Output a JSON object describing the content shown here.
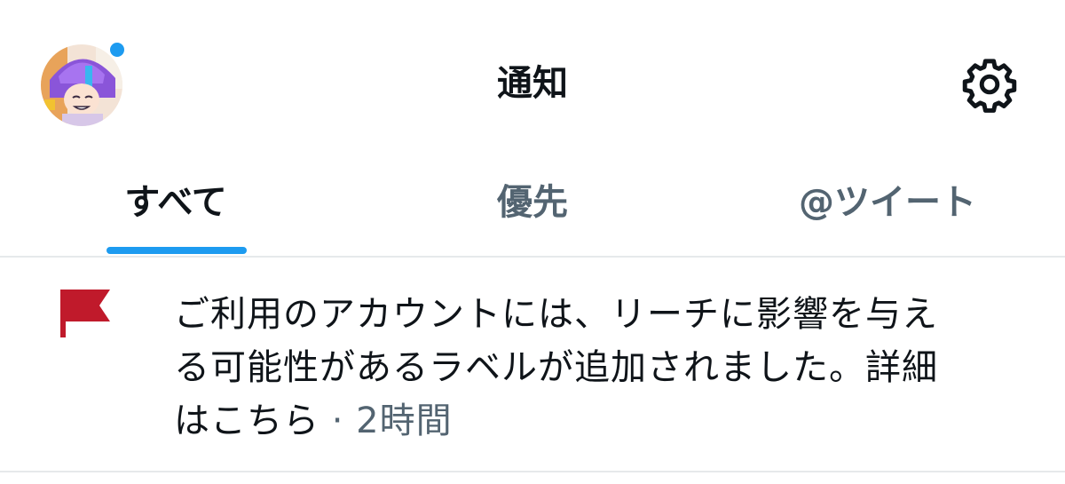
{
  "header": {
    "title": "通知",
    "avatar_icon": "user-avatar",
    "settings_icon": "gear-icon",
    "unread_dot_color": "#1d9bf0"
  },
  "tabs": [
    {
      "label": "すべて",
      "selected": true
    },
    {
      "label": "優先",
      "selected": false
    },
    {
      "label": "@ツイート",
      "selected": false
    }
  ],
  "colors": {
    "accent": "#1d9bf0",
    "text_primary": "#0f1419",
    "text_secondary": "#536471",
    "flag": "#c01a2b"
  },
  "notification": {
    "icon": "flag-icon",
    "line1": "ご利用のアカウントには、リーチに影響を与え",
    "line2": "る可能性があるラベルが追加されました。詳細",
    "line3": "はこちら",
    "separator": " · ",
    "time": "2時間"
  }
}
